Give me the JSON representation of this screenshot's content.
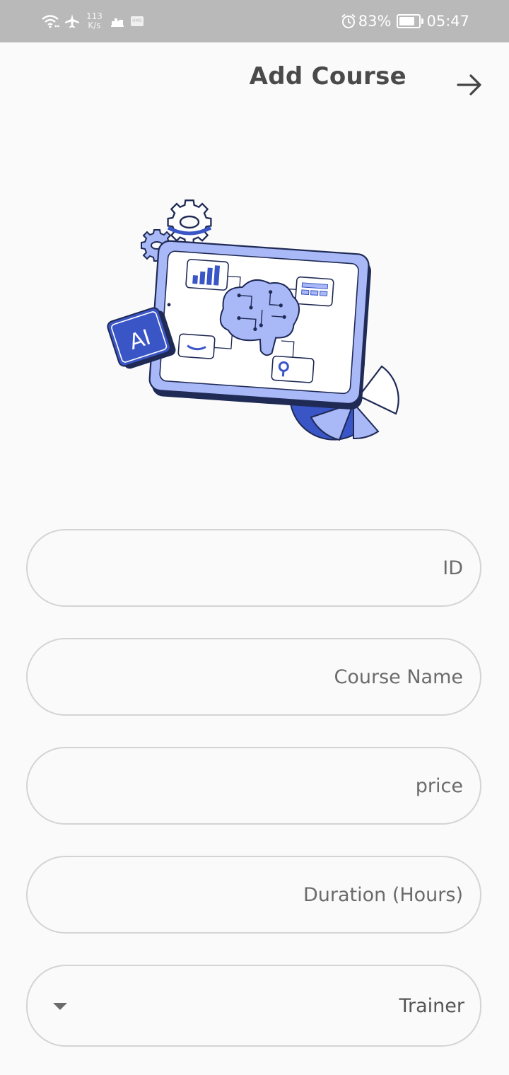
{
  "status_bar": {
    "net_speed_value": "113",
    "net_speed_unit": "K/s",
    "hms_badge": "HMS",
    "battery_percent": "83%",
    "battery_level": 0.83,
    "time": "05:47",
    "icons": [
      "wifi-icon",
      "airplane-icon",
      "notification-icon",
      "hms-icon",
      "alarm-icon",
      "battery-icon"
    ]
  },
  "header": {
    "title": "Add Course",
    "action_icon": "arrow-right-icon"
  },
  "illustration": {
    "badge_text": "AI",
    "icon": "ai-brain-dashboard-illustration"
  },
  "form": {
    "id_placeholder": "ID",
    "course_name_placeholder": "Course Name",
    "price_placeholder": "price",
    "duration_placeholder": "Duration (Hours)",
    "trainer_label": "Trainer",
    "trainer_icon": "dropdown-caret-icon"
  },
  "colors": {
    "status_bar_bg": "#b9b9b9",
    "background": "#fafafa",
    "title": "#4a4a4a",
    "field_border": "#d4d4d4",
    "accent_blue": "#3a55c6",
    "accent_light": "#a9b8f7"
  }
}
